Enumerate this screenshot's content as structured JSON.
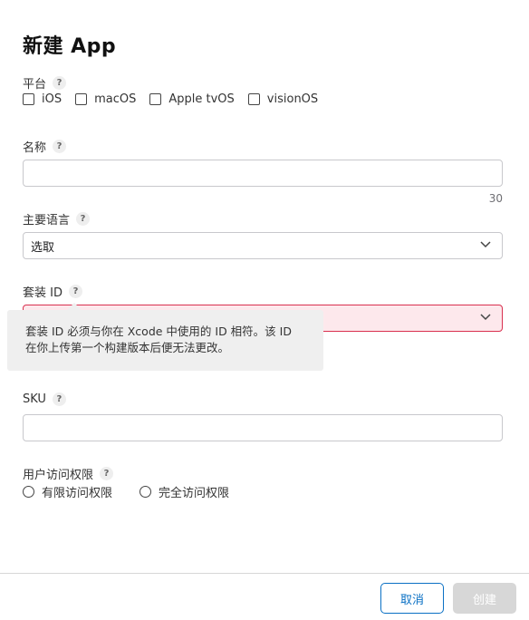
{
  "page_title": "新建 App",
  "help_glyph": "?",
  "platform": {
    "label": "平台",
    "options": [
      "iOS",
      "macOS",
      "Apple tvOS",
      "visionOS"
    ]
  },
  "name": {
    "label": "名称",
    "value": "",
    "counter": "30"
  },
  "language": {
    "label": "主要语言",
    "selected": "选取"
  },
  "bundle_id": {
    "label": "套装 ID",
    "selected": "",
    "tooltip_line1": "套装 ID 必须与你在 Xcode 中使用的 ID 相符。该 ID",
    "tooltip_line2": "在你上传第一个构建版本后便无法更改。"
  },
  "sku": {
    "label": "SKU",
    "value": ""
  },
  "user_access": {
    "label": "用户访问权限",
    "options": [
      "有限访问权限",
      "完全访问权限"
    ]
  },
  "buttons": {
    "cancel": "取消",
    "create": "创建"
  },
  "colors": {
    "accent": "#0a70c4",
    "error_border": "#d9304f",
    "error_fill": "#fde8ec"
  }
}
